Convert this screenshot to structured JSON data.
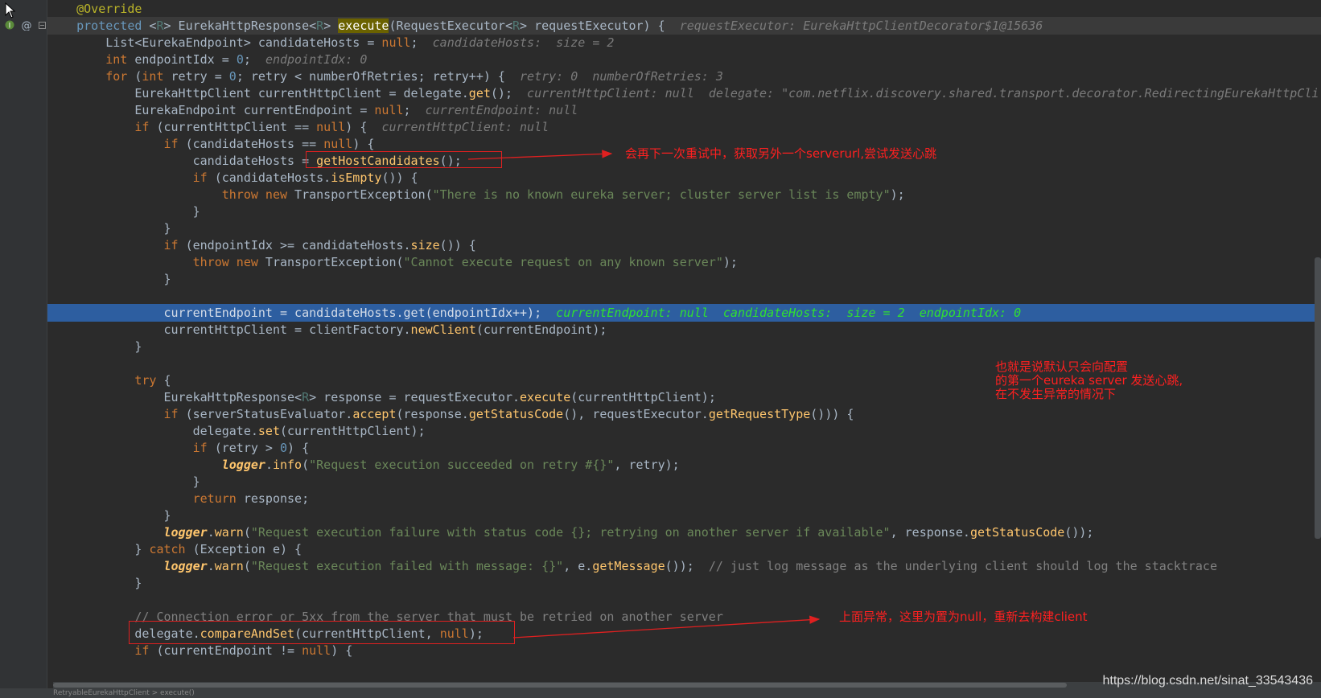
{
  "hints": {
    "execute_param": "requestExecutor: EurekaHttpClientDecorator$1@15636",
    "candidate_hosts": "candidateHosts:  size = 2",
    "endpoint_idx": "endpointIdx: 0",
    "retry": "retry: 0  numberOfRetries: 3",
    "current_client": "currentHttpClient: null  delegate: \"com.netflix.discovery.shared.transport.decorator.RedirectingEurekaHttpCli",
    "current_endpoint": "currentEndpoint: null",
    "current_client_null": "currentHttpClient: null",
    "exec_line": "currentEndpoint: null  candidateHosts:  size = 2  endpointIdx: 0"
  },
  "strings": {
    "no_server": "\"There is no known eureka server; cluster server list is empty\"",
    "cannot_execute": "\"Cannot execute request on any known server\"",
    "succeeded": "\"Request execution succeeded on retry #{}\"",
    "failure": "\"Request execution failure with status code {}; retrying on another server if available\"",
    "failed": "\"Request execution failed with message: {}\""
  },
  "comments": {
    "just_log": "// just log message as the underlying client should log the stacktrace",
    "connection_error": "// Connection error or 5xx from the server that must be retried on another server"
  },
  "notes": {
    "retry_server": "会再下一次重试中，获取另外一个serverurl,尝试发送心跳",
    "default_first": "也就是说默认只会向配置\n的第一个eureka server 发送心跳,\n在不发生异常的情况下",
    "reset_null": "上面异常，这里为置为null，重新去构建client"
  },
  "watermark": "https://blog.csdn.net/sinat_33543436",
  "status_text": "RetryableEurekaHttpClient > execute()",
  "colors": {
    "background": "#2b2b2b",
    "keyword": "#cc7832",
    "string": "#6a8759",
    "method": "#ffc66d",
    "annotation_red": "#ff2020",
    "exec_line": "#2d5ea0"
  }
}
